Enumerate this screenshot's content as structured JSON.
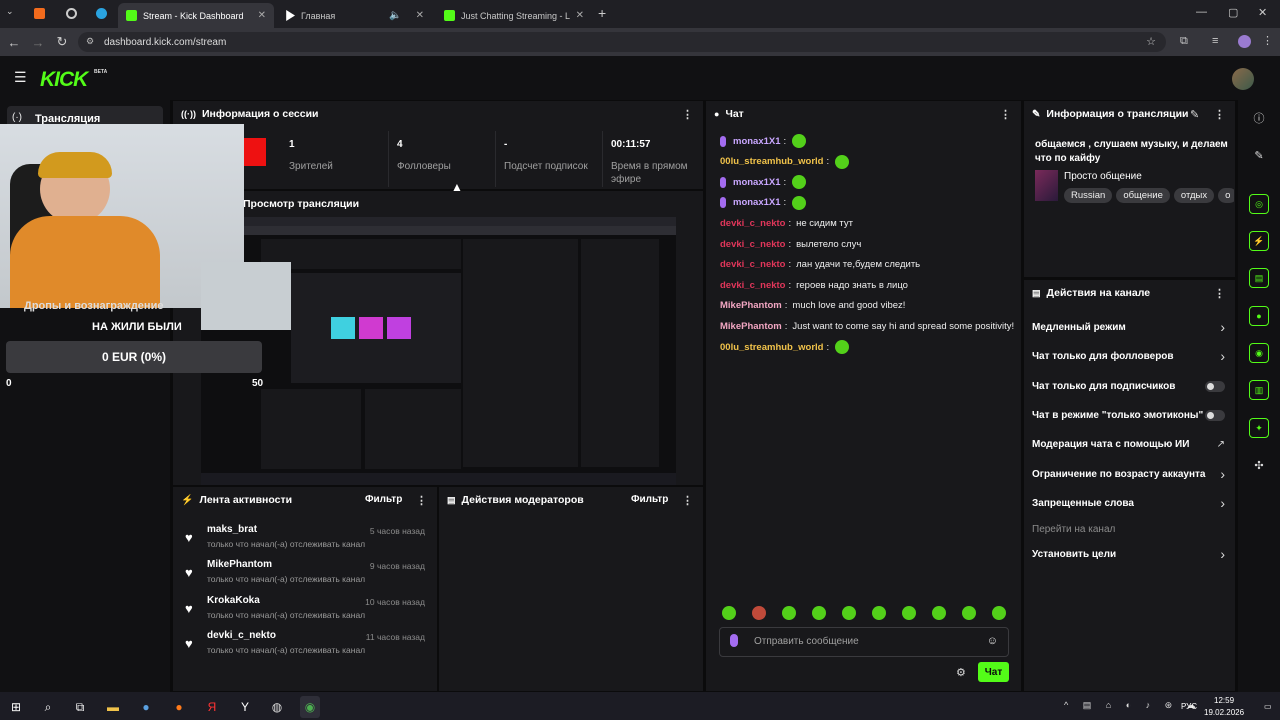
{
  "browser": {
    "tabs": [
      {
        "label": "Stream - Kick Dashboard",
        "active": true
      },
      {
        "label": "Главная",
        "active": false
      },
      {
        "label": "Just Chatting Streaming - Live",
        "active": false
      }
    ],
    "url": "dashboard.kick.com/stream"
  },
  "kick": {
    "logo": "KICK",
    "beta": "BETA"
  },
  "left": {
    "stream_label": "Трансляция",
    "donation_title": "Дропы и вознаграждение",
    "donation_sub": "НА ЖИЛИ БЫЛИ",
    "donation_amount": "0 EUR (0%)",
    "range_min": "0",
    "range_max": "50"
  },
  "session": {
    "title": "Информация о сессии",
    "stats": [
      {
        "value": "1",
        "label": "Зрителей"
      },
      {
        "value": "4",
        "label": "Фолловеры"
      },
      {
        "value": "-",
        "label": "Подсчет подписок"
      },
      {
        "value": "00:11:57",
        "label": "Время в прямом эфире"
      }
    ],
    "preview_title": "Просмотр трансляции"
  },
  "chat": {
    "title": "Чат",
    "messages": [
      {
        "user": "monax1X1",
        "text": "",
        "color": "#c9a7ff",
        "badge": true,
        "emote": true
      },
      {
        "user": "00lu_streamhub_world",
        "text": "",
        "color": "#f0c24a",
        "badge": false,
        "emote": true
      },
      {
        "user": "monax1X1",
        "text": "",
        "color": "#c9a7ff",
        "badge": true,
        "emote": true
      },
      {
        "user": "monax1X1",
        "text": "",
        "color": "#c9a7ff",
        "badge": true,
        "emote": true
      },
      {
        "user": "devki_c_nekto",
        "text": "не сидим тут",
        "color": "#e0365a",
        "badge": false,
        "emote": false
      },
      {
        "user": "devki_c_nekto",
        "text": "вылетело случ",
        "color": "#e0365a",
        "badge": false,
        "emote": false
      },
      {
        "user": "devki_c_nekto",
        "text": "лан удачи те,будем следить",
        "color": "#e0365a",
        "badge": false,
        "emote": false
      },
      {
        "user": "devki_c_nekto",
        "text": "героев надо знать в лицо",
        "color": "#e0365a",
        "badge": false,
        "emote": false
      },
      {
        "user": "MikePhantom",
        "text": "much love and good vibez!",
        "color": "#f2a6c2",
        "badge": false,
        "emote": false
      },
      {
        "user": "MikePhantom",
        "text": "Just want to come say hi and spread some positivity!",
        "color": "#f2a6c2",
        "badge": false,
        "emote": false
      },
      {
        "user": "00lu_streamhub_world",
        "text": "",
        "color": "#f0c24a",
        "badge": false,
        "emote": true
      }
    ],
    "placeholder": "Отправить сообщение",
    "send_label": "Чат"
  },
  "stream_info": {
    "title": "Информация о трансляции",
    "stream_title": "общаемся , слушаем музыку, и делаем что по кайфу",
    "category": "Просто общение",
    "tags": [
      "Russian",
      "общение",
      "отдых",
      "о"
    ]
  },
  "channel_actions": {
    "title": "Действия на канале",
    "items": [
      {
        "label": "Медленный режим",
        "control": "chevron"
      },
      {
        "label": "Чат только для фолловеров",
        "control": "chevron"
      },
      {
        "label": "Чат только для подписчиков",
        "control": "toggle"
      },
      {
        "label": "Чат в режиме \"только эмотиконы\"",
        "control": "toggle"
      },
      {
        "label": "Модерация чата с помощью ИИ",
        "control": "external"
      },
      {
        "label": "Ограничение по возрасту аккаунта",
        "control": "chevron"
      },
      {
        "label": "Запрещенные слова",
        "control": "chevron"
      },
      {
        "label": "Перейти на канал",
        "control": "none"
      },
      {
        "label": "Установить цели",
        "control": "chevron"
      }
    ]
  },
  "activity": {
    "title": "Лента активности",
    "filter": "Фильтр",
    "items": [
      {
        "name": "maks_brat",
        "time": "5 часов назад",
        "desc": "только что начал(-а) отслеживать канал"
      },
      {
        "name": "MikePhantom",
        "time": "9 часов назад",
        "desc": "только что начал(-а) отслеживать канал"
      },
      {
        "name": "KrokaKoka",
        "time": "10 часов назад",
        "desc": "только что начал(-а) отслеживать канал"
      },
      {
        "name": "devki_c_nekto",
        "time": "11 часов назад",
        "desc": "только что начал(-а) отслеживать канал"
      }
    ]
  },
  "mod": {
    "title": "Действия модераторов",
    "filter": "Фильтр"
  },
  "taskbar": {
    "lang": "РУС",
    "time": "12:59",
    "date": "19.02.2026"
  },
  "colors": {
    "accent": "#53fc18",
    "panel": "#18181b",
    "bg": "#0b0b0c"
  }
}
